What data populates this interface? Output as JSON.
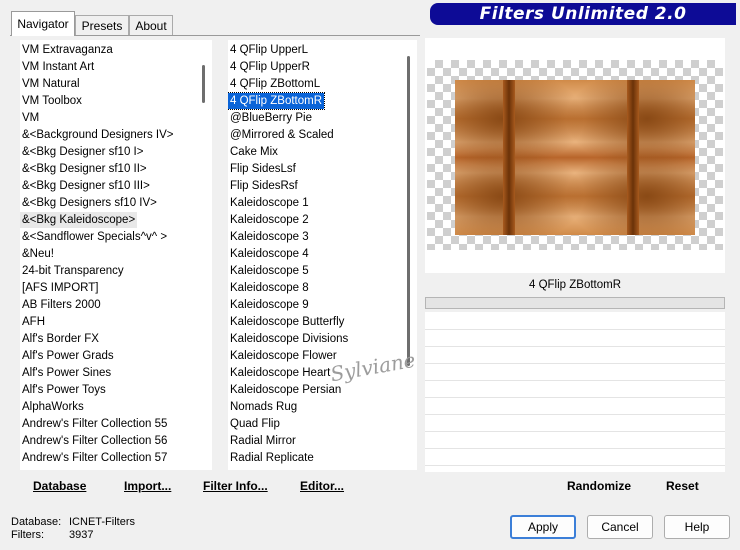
{
  "tabs": [
    "Navigator",
    "Presets",
    "About"
  ],
  "banner_title": "Filters Unlimited 2.0",
  "categories": [
    "VM Extravaganza",
    "VM Instant Art",
    "VM Natural",
    "VM Toolbox",
    "VM",
    "&<Background Designers IV>",
    "&<Bkg Designer sf10 I>",
    "&<Bkg Designer sf10 II>",
    "&<Bkg Designer sf10 III>",
    "&<Bkg Designers sf10 IV>",
    "&<Bkg Kaleidoscope>",
    "&<Sandflower Specials^v^ >",
    "&Neu!",
    "24-bit Transparency",
    "[AFS IMPORT]",
    "AB Filters 2000",
    "AFH",
    "Alf's Border FX",
    "Alf's Power Grads",
    "Alf's Power Sines",
    "Alf's Power Toys",
    "AlphaWorks",
    "Andrew's Filter Collection 55",
    "Andrew's Filter Collection 56",
    "Andrew's Filter Collection 57"
  ],
  "selected_category": "&<Bkg Kaleidoscope>",
  "filters": [
    "4 QFlip UpperL",
    "4 QFlip UpperR",
    "4 QFlip ZBottomL",
    "4 QFlip ZBottomR",
    "@BlueBerry Pie",
    "@Mirrored & Scaled",
    "Cake Mix",
    "Flip SidesLsf",
    "Flip SidesRsf",
    "Kaleidoscope 1",
    "Kaleidoscope 2",
    "Kaleidoscope 3",
    "Kaleidoscope 4",
    "Kaleidoscope 5",
    "Kaleidoscope 8",
    "Kaleidoscope 9",
    "Kaleidoscope Butterfly",
    "Kaleidoscope Divisions",
    "Kaleidoscope Flower",
    "Kaleidoscope Heart",
    "Kaleidoscope Persian",
    "Nomads Rug",
    "Quad Flip",
    "Radial Mirror",
    "Radial Replicate"
  ],
  "selected_filter": "4 QFlip ZBottomR",
  "preview_filter_name": "4 QFlip ZBottomR",
  "bottom_links": {
    "database": "Database",
    "import": "Import...",
    "filter_info": "Filter Info...",
    "editor": "Editor...",
    "randomize": "Randomize",
    "reset": "Reset"
  },
  "status": {
    "database_label": "Database:",
    "database_value": "ICNET-Filters",
    "filters_label": "Filters:",
    "filters_value": "3937"
  },
  "buttons": {
    "apply": "Apply",
    "cancel": "Cancel",
    "help": "Help"
  },
  "watermark": "Sylviane",
  "colors": {
    "banner": "#0d0b96",
    "selection": "#0a64d8",
    "default_button_border": "#3c7fd8"
  }
}
